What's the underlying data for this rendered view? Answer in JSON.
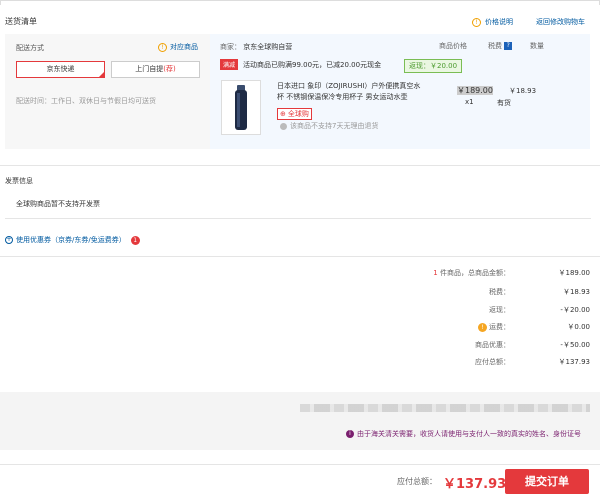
{
  "header": {
    "title": "送货清单",
    "price_explain": "价格说明",
    "back_to_cart": "返回修改购物车"
  },
  "delivery": {
    "label": "配送方式",
    "match_goods": "对应商品",
    "option_jd": "京东快递",
    "option_self_prefix": "上门自提",
    "option_self_tag": "(荐)",
    "time": "配送时间：工作日、双休日与节假日均可送货"
  },
  "order": {
    "merchant_label": "商家：",
    "merchant_name": "京东全球购自营",
    "col_price": "商品价格",
    "col_tax": "税费",
    "col_tax_icon": "?",
    "col_qty": "数量",
    "promo_tag": "满减",
    "promo_text": "活动商品已购满99.00元，已减20.00元现金",
    "promo_back": "返现：￥20.00",
    "product_name": "日本进口 象印（ZOJIRUSHI）户外便携真空水杯 不锈钢保温保冷专用杯子 男女运动水壶",
    "global_tag": "全球购",
    "no_return": "该商品不支持7天无理由退货",
    "price": "￥189.00",
    "tax": "￥18.93",
    "qty": "x1",
    "stock": "有货"
  },
  "invoice": {
    "title": "发票信息",
    "text": "全球购商品暂不支持开发票"
  },
  "coupon": {
    "text": "使用优惠券（京券/东券/免运费券）",
    "badge": "1"
  },
  "summary": {
    "count": "1",
    "count_suffix": " 件商品，总商品金额：",
    "rows": [
      {
        "label": "税费：",
        "value": "￥18.93"
      },
      {
        "label": "返现：",
        "value": "-￥20.00"
      },
      {
        "label": "运费：",
        "value": "￥0.00"
      },
      {
        "label": "商品优惠：",
        "value": "-￥50.00"
      },
      {
        "label": "应付总额：",
        "value": "￥137.93"
      }
    ],
    "goods_total": "￥189.00"
  },
  "address": {
    "customs_prefix": "由于海关清关需要，收货人请使用与支付人一致的真实的姓名、身份证号"
  },
  "footer": {
    "total_label": "应付总额：",
    "total_value": "￥137.93",
    "submit": "提交订单"
  },
  "colors": {
    "accent": "#e4393c",
    "link": "#005aa0",
    "green": "#4b9a2e"
  }
}
